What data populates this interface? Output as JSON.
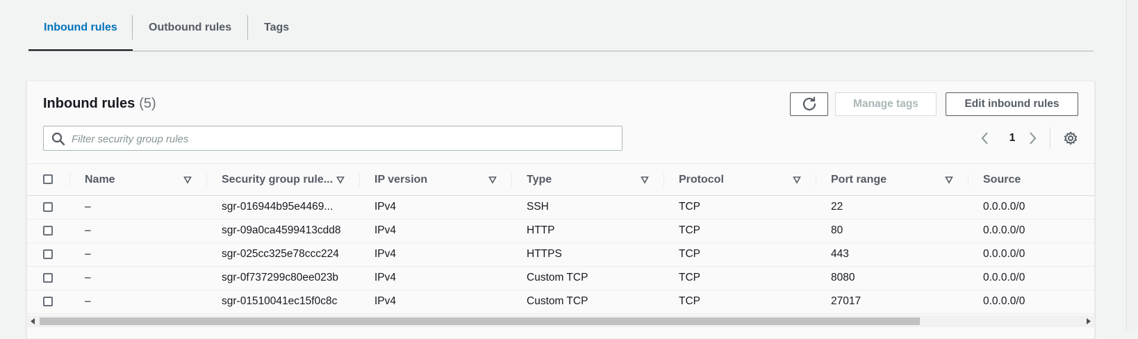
{
  "tabs": [
    {
      "label": "Inbound rules"
    },
    {
      "label": "Outbound rules"
    },
    {
      "label": "Tags"
    }
  ],
  "panel": {
    "title": "Inbound rules",
    "count": "(5)",
    "refresh_icon": "refresh-icon",
    "manage_tags_label": "Manage tags",
    "edit_label": "Edit inbound rules",
    "search_placeholder": "Filter security group rules",
    "page": "1"
  },
  "columns": [
    {
      "label": "Name"
    },
    {
      "label": "Security group rule..."
    },
    {
      "label": "IP version"
    },
    {
      "label": "Type"
    },
    {
      "label": "Protocol"
    },
    {
      "label": "Port range"
    },
    {
      "label": "Source"
    }
  ],
  "rows": [
    {
      "name": "–",
      "rule_id": "sgr-016944b95e4469...",
      "ip": "IPv4",
      "type": "SSH",
      "protocol": "TCP",
      "port": "22",
      "source": "0.0.0.0/0"
    },
    {
      "name": "–",
      "rule_id": "sgr-09a0ca4599413cdd8",
      "ip": "IPv4",
      "type": "HTTP",
      "protocol": "TCP",
      "port": "80",
      "source": "0.0.0.0/0"
    },
    {
      "name": "–",
      "rule_id": "sgr-025cc325e78ccc224",
      "ip": "IPv4",
      "type": "HTTPS",
      "protocol": "TCP",
      "port": "443",
      "source": "0.0.0.0/0"
    },
    {
      "name": "–",
      "rule_id": "sgr-0f737299c80ee023b",
      "ip": "IPv4",
      "type": "Custom TCP",
      "protocol": "TCP",
      "port": "8080",
      "source": "0.0.0.0/0"
    },
    {
      "name": "–",
      "rule_id": "sgr-01510041ec15f0c8c",
      "ip": "IPv4",
      "type": "Custom TCP",
      "protocol": "TCP",
      "port": "27017",
      "source": "0.0.0.0/0"
    }
  ],
  "colors": {
    "accent": "#0073bb",
    "text": "#16191f",
    "muted": "#545b64"
  }
}
